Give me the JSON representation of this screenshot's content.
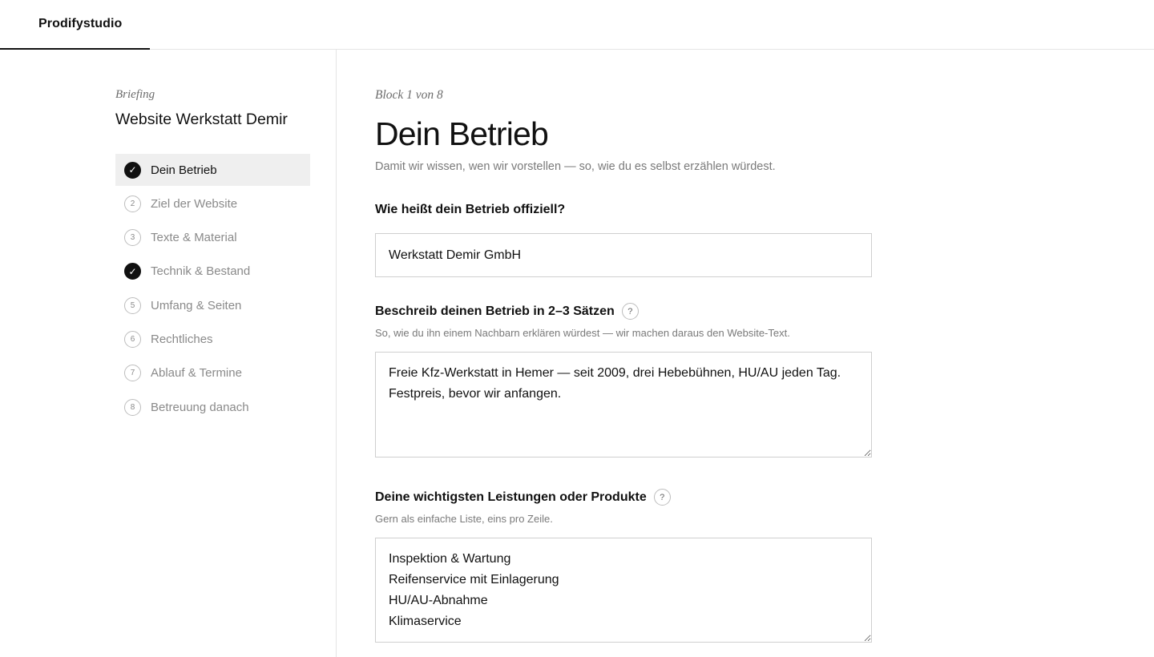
{
  "brand": {
    "name": "Prodifystudio"
  },
  "sidebar": {
    "eyebrow": "Briefing",
    "title": "Website Werkstatt Demir",
    "steps": [
      {
        "marker": "✓",
        "label": "Dein Betrieb",
        "state": "active-done"
      },
      {
        "marker": "2",
        "label": "Ziel der Website",
        "state": "pending"
      },
      {
        "marker": "3",
        "label": "Texte & Material",
        "state": "pending"
      },
      {
        "marker": "✓",
        "label": "Technik & Bestand",
        "state": "done"
      },
      {
        "marker": "5",
        "label": "Umfang & Seiten",
        "state": "pending"
      },
      {
        "marker": "6",
        "label": "Rechtliches",
        "state": "pending"
      },
      {
        "marker": "7",
        "label": "Ablauf & Termine",
        "state": "pending"
      },
      {
        "marker": "8",
        "label": "Betreuung danach",
        "state": "pending"
      }
    ]
  },
  "main": {
    "eyebrow": "Block 1 von 8",
    "title": "Dein Betrieb",
    "lede": "Damit wir wissen, wen wir vorstellen — so, wie du es selbst erzählen würdest.",
    "q1": {
      "label": "Wie heißt dein Betrieb offiziell?",
      "value": "Werkstatt Demir GmbH"
    },
    "q2": {
      "label": "Beschreib deinen Betrieb in 2–3 Sätzen",
      "help": "?",
      "hint": "So, wie du ihn einem Nachbarn erklären würdest — wir machen daraus den Website-Text.",
      "value": "Freie Kfz-Werkstatt in Hemer — seit 2009, drei Hebebühnen, HU/AU jeden Tag. Festpreis, bevor wir anfangen."
    },
    "q3": {
      "label": "Deine wichtigsten Leistungen oder Produkte",
      "help": "?",
      "hint": "Gern als einfache Liste, eins pro Zeile.",
      "value": "Inspektion & Wartung\nReifenservice mit Einlagerung\nHU/AU-Abnahme\nKlimaservice"
    }
  },
  "colors": {
    "accent": "#111111",
    "muted": "#8a8a8a",
    "border": "#cfcfcf",
    "active_bg": "#efefef"
  }
}
